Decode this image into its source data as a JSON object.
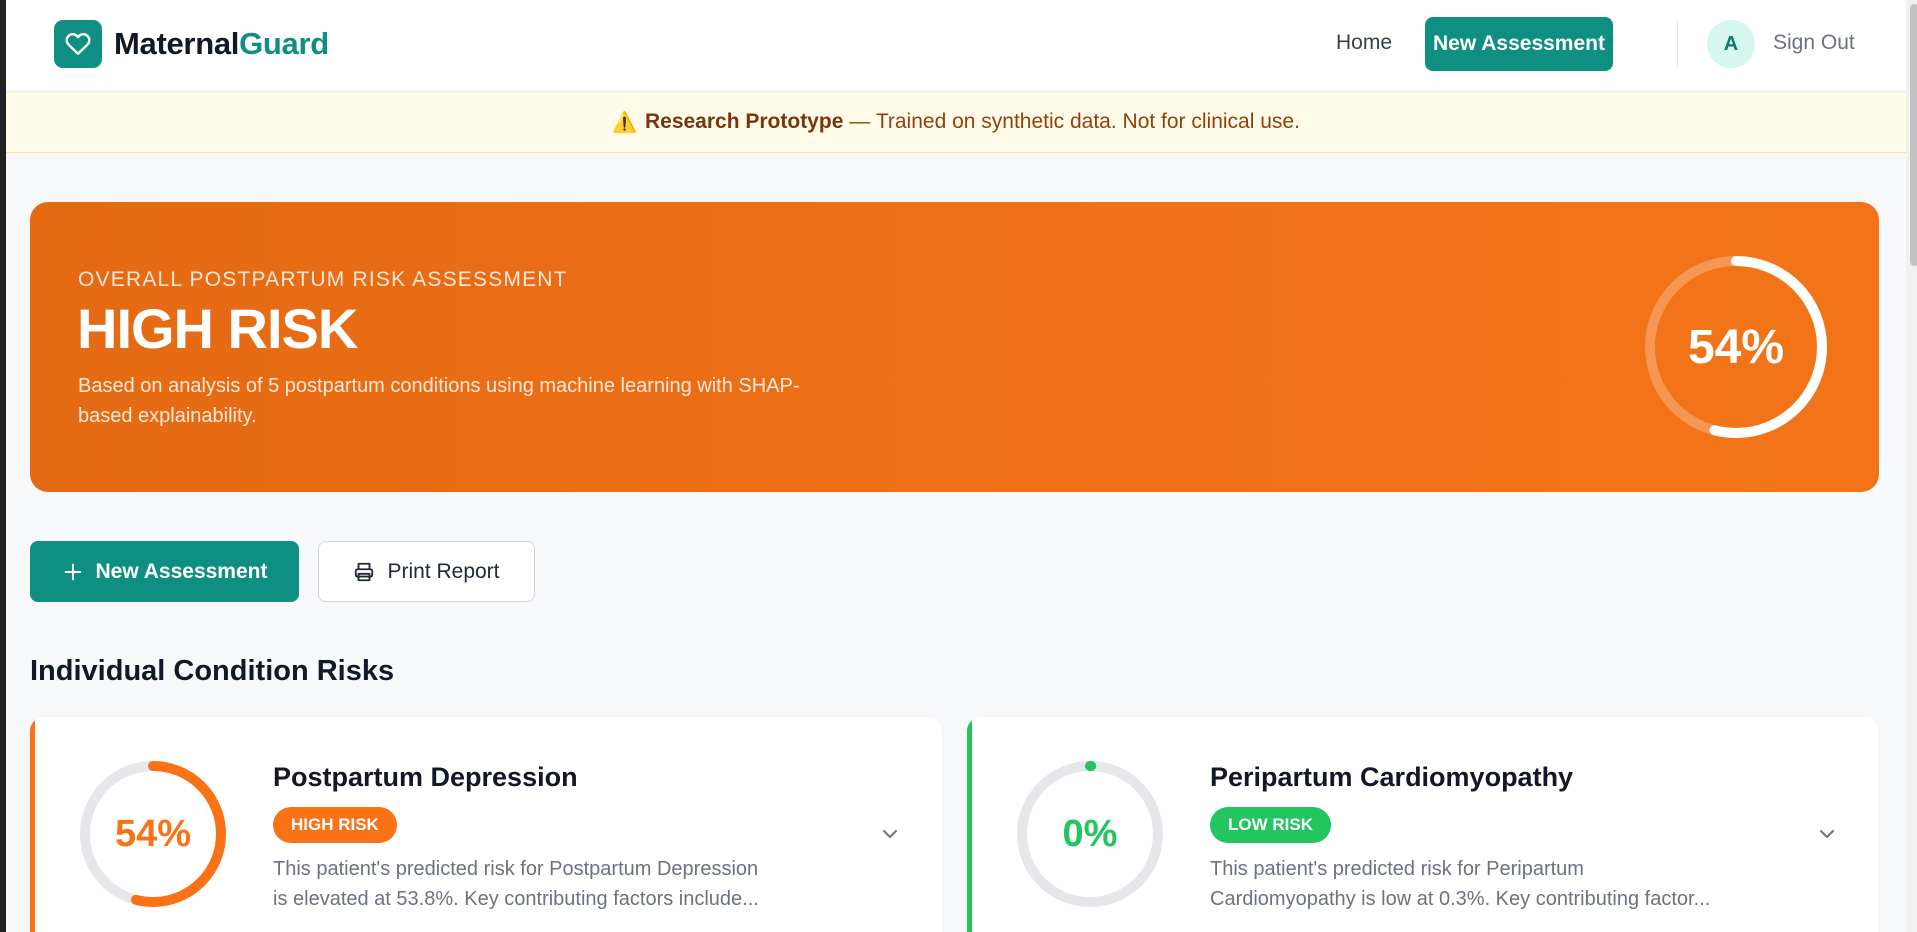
{
  "header": {
    "brand_part1": "Maternal",
    "brand_part2": "Guard",
    "logo_icon": "heart-icon",
    "nav_home": "Home",
    "nav_new_assessment": "New Assessment",
    "avatar_initial": "A",
    "sign_out": "Sign Out"
  },
  "banner": {
    "icon": "warning-icon",
    "strong": "Research Prototype",
    "text": "— Trained on synthetic data. Not for clinical use."
  },
  "hero": {
    "kicker": "OVERALL POSTPARTUM RISK ASSESSMENT",
    "title": "HIGH RISK",
    "description": "Based on analysis of 5 postpartum conditions using machine learning with SHAP-based explainability.",
    "percent_label": "54%",
    "percent_value": 0.54,
    "background_color": "#f07118"
  },
  "actions": {
    "new_assessment": "New Assessment",
    "print_report": "Print Report"
  },
  "section_title": "Individual Condition Risks",
  "conditions": [
    {
      "title": "Postpartum Depression",
      "badge": "HIGH RISK",
      "percent_label": "54%",
      "percent_value": 0.54,
      "color": "#f97316",
      "desc_line1": "This patient's predicted risk for Postpartum Depression",
      "desc_line2": "is elevated at 53.8%. Key contributing factors include..."
    },
    {
      "title": "Peripartum Cardiomyopathy",
      "badge": "LOW RISK",
      "percent_label": "0%",
      "percent_value": 0.003,
      "color": "#22c55e",
      "desc_line1": "This patient's predicted risk for Peripartum",
      "desc_line2": "Cardiomyopathy is low at 0.3%. Key contributing factor..."
    }
  ],
  "colors": {
    "brand": "#0f8f82",
    "high_risk": "#f97316",
    "low_risk": "#22c55e"
  }
}
